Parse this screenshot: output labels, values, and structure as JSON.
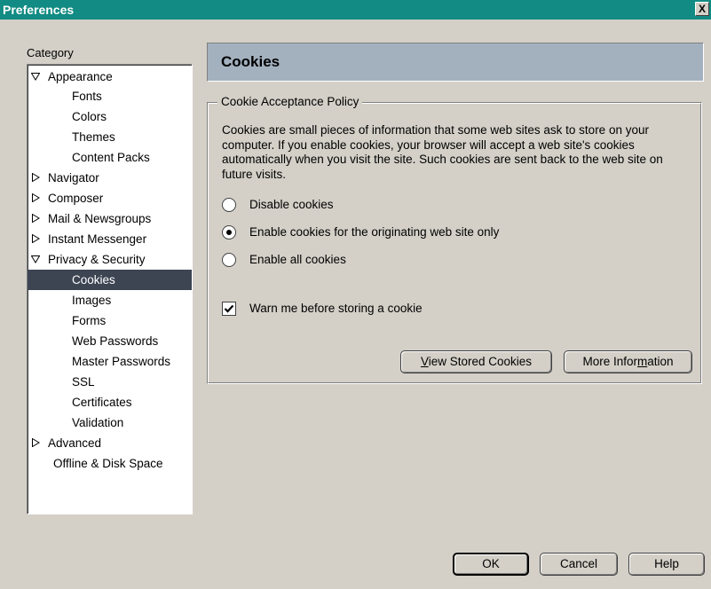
{
  "window": {
    "title": "Preferences",
    "close_label": "X"
  },
  "sidebar": {
    "label": "Category",
    "items": [
      {
        "label": "Appearance",
        "twisty": "expanded"
      },
      {
        "label": "Fonts"
      },
      {
        "label": "Colors"
      },
      {
        "label": "Themes"
      },
      {
        "label": "Content Packs"
      },
      {
        "label": "Navigator",
        "twisty": "collapsed"
      },
      {
        "label": "Composer",
        "twisty": "collapsed"
      },
      {
        "label": "Mail & Newsgroups",
        "twisty": "collapsed"
      },
      {
        "label": "Instant Messenger",
        "twisty": "collapsed"
      },
      {
        "label": "Privacy & Security",
        "twisty": "expanded"
      },
      {
        "label": "Cookies",
        "selected": true
      },
      {
        "label": "Images"
      },
      {
        "label": "Forms"
      },
      {
        "label": "Web Passwords"
      },
      {
        "label": "Master Passwords"
      },
      {
        "label": "SSL"
      },
      {
        "label": "Certificates"
      },
      {
        "label": "Validation"
      },
      {
        "label": "Advanced",
        "twisty": "collapsed"
      },
      {
        "label": "Offline & Disk Space"
      }
    ]
  },
  "panel": {
    "title": "Cookies",
    "group_label": "Cookie Acceptance Policy",
    "description": "Cookies are small pieces of information that some web sites ask to store on your computer. If you enable cookies, your browser will accept a web site's cookies automatically when you visit the site. Such cookies are sent back to the web site on future visits.",
    "radios": [
      {
        "label": "Disable cookies",
        "selected": false
      },
      {
        "label": "Enable cookies for the originating web site only",
        "selected": true
      },
      {
        "label": "Enable all cookies",
        "selected": false
      }
    ],
    "warn_checkbox": {
      "label": "Warn me before storing a cookie",
      "checked": true
    },
    "view_stored_button": {
      "pre": "",
      "accel": "V",
      "post": "iew Stored Cookies"
    },
    "more_info_button": {
      "pre": "More Infor",
      "accel": "m",
      "post": "ation"
    }
  },
  "footer": {
    "ok": "OK",
    "cancel": "Cancel",
    "help": "Help"
  }
}
